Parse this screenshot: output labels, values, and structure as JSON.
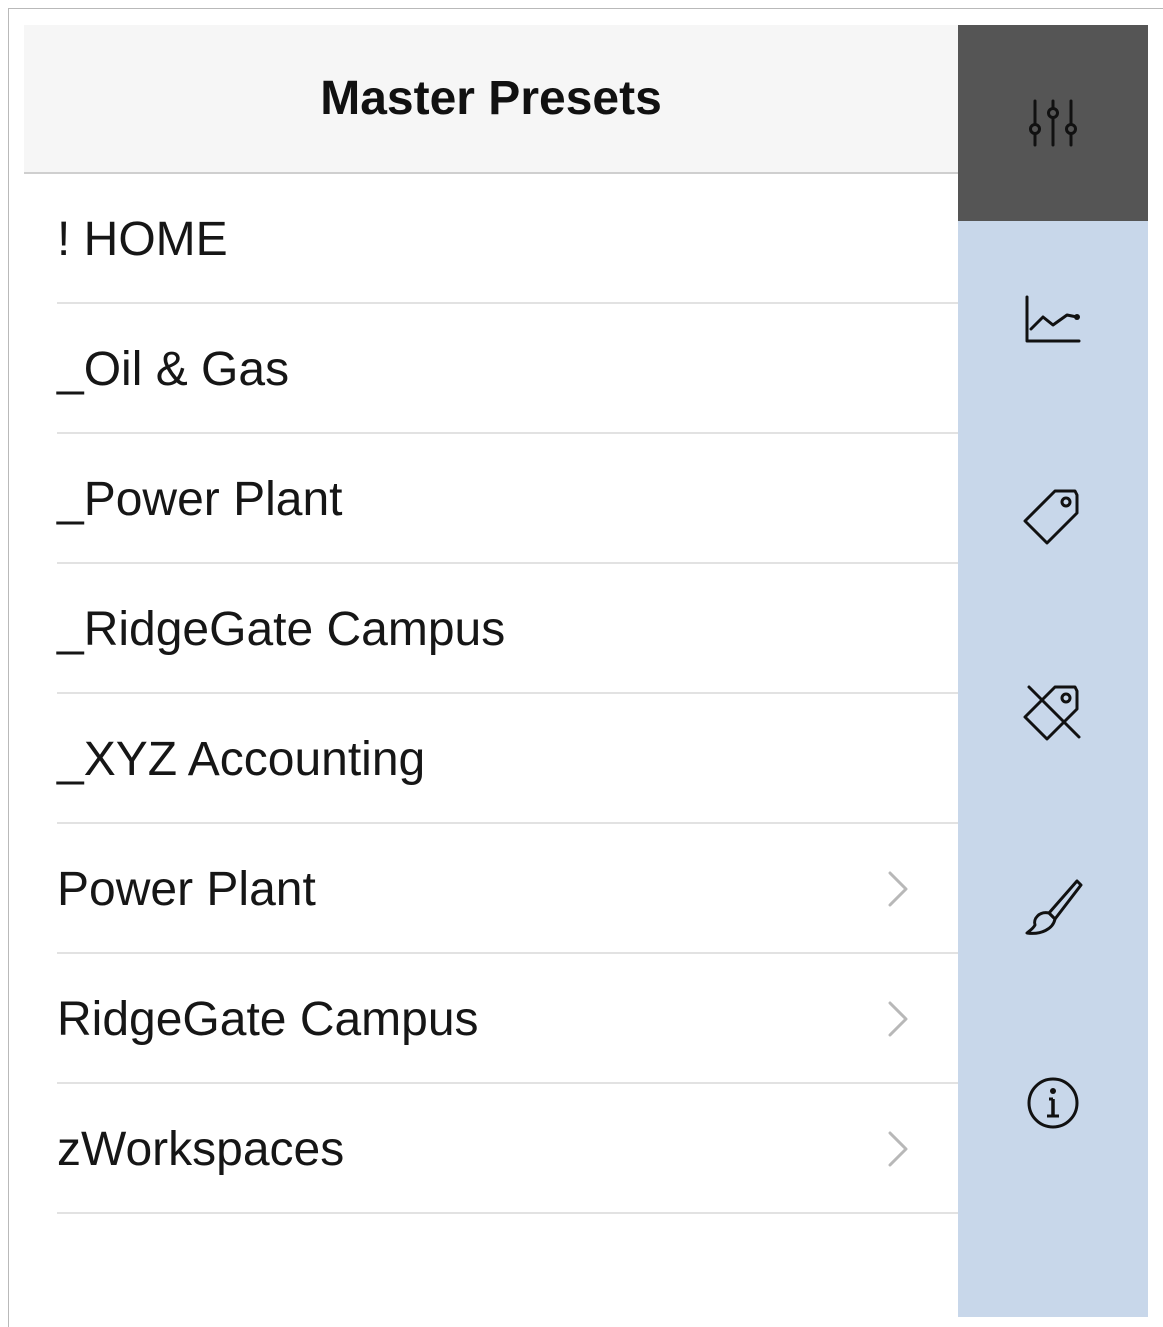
{
  "header": {
    "title": "Master Presets"
  },
  "presets": [
    {
      "label": "! HOME",
      "has_children": false
    },
    {
      "label": "_Oil & Gas",
      "has_children": false
    },
    {
      "label": "_Power Plant",
      "has_children": false
    },
    {
      "label": "_RidgeGate Campus",
      "has_children": false
    },
    {
      "label": "_XYZ Accounting",
      "has_children": false
    },
    {
      "label": "Power Plant",
      "has_children": true
    },
    {
      "label": "RidgeGate Campus",
      "has_children": true
    },
    {
      "label": "zWorkspaces",
      "has_children": true
    }
  ],
  "sidebar": {
    "items": [
      {
        "icon": "sliders-icon",
        "active": true
      },
      {
        "icon": "chart-line-icon",
        "active": false
      },
      {
        "icon": "tag-icon",
        "active": false
      },
      {
        "icon": "tag-off-icon",
        "active": false
      },
      {
        "icon": "brush-icon",
        "active": false
      },
      {
        "icon": "info-icon",
        "active": false
      }
    ]
  },
  "colors": {
    "sidebar_bg": "#c8d7ea",
    "sidebar_active_bg": "#555555",
    "header_bg": "#f6f6f6",
    "divider": "#e2e2e2",
    "chevron": "#b8b8b8"
  }
}
